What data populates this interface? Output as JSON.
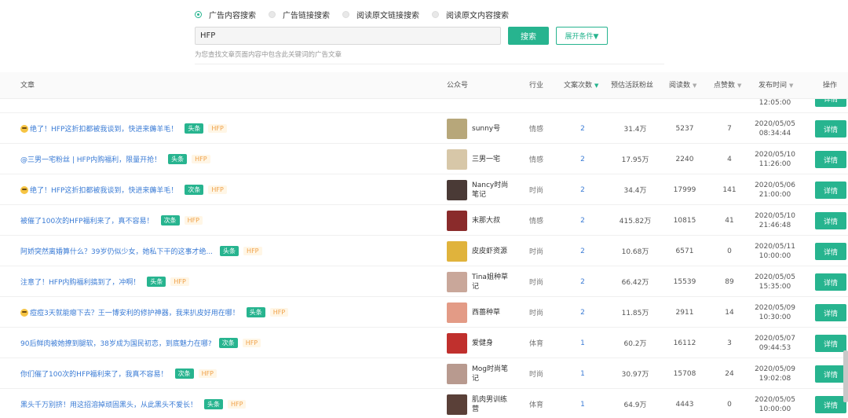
{
  "search": {
    "modes": [
      {
        "label": "广告内容搜索",
        "active": true
      },
      {
        "label": "广告链接搜索",
        "active": false
      },
      {
        "label": "阅读原文链接搜索",
        "active": false
      },
      {
        "label": "阅读原文内容搜索",
        "active": false
      }
    ],
    "query": "HFP",
    "search_label": "搜索",
    "expand_label": "展开条件▼",
    "hint": "为您查找文章页面内容中包含此关键词的广告文章"
  },
  "table": {
    "headers": {
      "article": "文章",
      "account": "公众号",
      "industry": "行业",
      "times": "文案次数",
      "fans": "预估活跃粉丝",
      "reads": "阅读数",
      "likes": "点赞数",
      "publish": "发布时间",
      "action": "操作"
    },
    "partial_row": {
      "time": "12:05:00",
      "detail": "详情"
    },
    "rows": [
      {
        "emoji": true,
        "title": "绝了！HFP这折扣都被我谈到，快进来薅羊毛！",
        "tag": "头条",
        "hfp": "HFP",
        "account": [
          "sunny号"
        ],
        "industry": "情感",
        "times": "2",
        "fans": "31.4万",
        "reads": "5237",
        "likes": "7",
        "date": "2020/05/05",
        "time": "08:34:44",
        "detail": "详情",
        "avatar_color": "#b7a77a"
      },
      {
        "emoji": false,
        "title": "@三男一宅粉丝 | HFP内购福利，限量开抢！",
        "tag": "头条",
        "hfp": "HFP",
        "account": [
          "三男一宅"
        ],
        "industry": "情感",
        "times": "2",
        "fans": "17.95万",
        "reads": "2240",
        "likes": "4",
        "date": "2020/05/10",
        "time": "11:26:00",
        "detail": "详情",
        "avatar_color": "#d7c7a8"
      },
      {
        "emoji": true,
        "title": "绝了！HFP这折扣都被我谈到，快进来薅羊毛！",
        "tag": "次条",
        "hfp": "HFP",
        "account": [
          "Nancy时尚",
          "笔记"
        ],
        "industry": "时尚",
        "times": "2",
        "fans": "34.4万",
        "reads": "17999",
        "likes": "141",
        "date": "2020/05/06",
        "time": "21:00:00",
        "detail": "详情",
        "avatar_color": "#4a3a36"
      },
      {
        "emoji": false,
        "title": "被催了100次的HFP福利来了，真不容易！",
        "tag": "次条",
        "hfp": "HFP",
        "account": [
          "末那大叔"
        ],
        "industry": "情感",
        "times": "2",
        "fans": "415.82万",
        "reads": "10815",
        "likes": "41",
        "date": "2020/05/10",
        "time": "21:46:48",
        "detail": "详情",
        "avatar_color": "#8a2b2b"
      },
      {
        "emoji": false,
        "title": "阿娇突然离婚算什么？39岁仍似少女，她私下干的这事才绝...",
        "tag": "头条",
        "hfp": "HFP",
        "account": [
          "皮皮虾资源"
        ],
        "industry": "时尚",
        "times": "2",
        "fans": "10.68万",
        "reads": "6571",
        "likes": "0",
        "date": "2020/05/11",
        "time": "10:00:00",
        "detail": "详情",
        "avatar_color": "#e0b33c"
      },
      {
        "emoji": false,
        "title": "注意了！HFP内购福利搞到了，冲啊！",
        "tag": "头条",
        "hfp": "HFP",
        "account": [
          "Tina姐种草",
          "记"
        ],
        "industry": "时尚",
        "times": "2",
        "fans": "66.42万",
        "reads": "15539",
        "likes": "89",
        "date": "2020/05/05",
        "time": "15:35:00",
        "detail": "详情",
        "avatar_color": "#c9a79a"
      },
      {
        "emoji": true,
        "title": "痘痘3天就能瘪下去？王一博安利的修护神器，我来扒皮好用在哪！",
        "tag": "头条",
        "hfp": "HFP",
        "account": [
          "西蔷种草"
        ],
        "industry": "时尚",
        "times": "2",
        "fans": "11.85万",
        "reads": "2911",
        "likes": "14",
        "date": "2020/05/09",
        "time": "10:30:00",
        "detail": "详情",
        "avatar_color": "#e39b86"
      },
      {
        "emoji": false,
        "title": "90后鲜肉被她撩到腿软，38岁成为国民初恋，到底魅力在哪?",
        "tag": "次条",
        "hfp": "HFP",
        "account": [
          "爱健身"
        ],
        "industry": "体育",
        "times": "1",
        "fans": "60.2万",
        "reads": "16112",
        "likes": "3",
        "date": "2020/05/07",
        "time": "09:44:53",
        "detail": "详情",
        "avatar_color": "#c0302d"
      },
      {
        "emoji": false,
        "title": "你们催了100次的HFP福利来了，我真不容易！",
        "tag": "次条",
        "hfp": "HFP",
        "account": [
          "Mog时尚笔",
          "记"
        ],
        "industry": "时尚",
        "times": "1",
        "fans": "30.97万",
        "reads": "15708",
        "likes": "24",
        "date": "2020/05/09",
        "time": "19:02:08",
        "detail": "详情",
        "avatar_color": "#b89a8f"
      },
      {
        "emoji": false,
        "title": "黑头千万别挤！用这招溶掉顽固黑头，从此黑头不爱长！",
        "tag": "头条",
        "hfp": "HFP",
        "account": [
          "肌肉男训练",
          "营"
        ],
        "industry": "体育",
        "times": "1",
        "fans": "64.9万",
        "reads": "4443",
        "likes": "0",
        "date": "2020/05/05",
        "time": "10:00:00",
        "detail": "详情",
        "avatar_color": "#5a4038"
      }
    ]
  },
  "colors": {
    "accent": "#27b48f",
    "link": "#3a7bd5",
    "tag_hfp": "#f0a24a"
  },
  "icons": {
    "sort": "caret-down-icon",
    "radio": "radio-icon"
  }
}
